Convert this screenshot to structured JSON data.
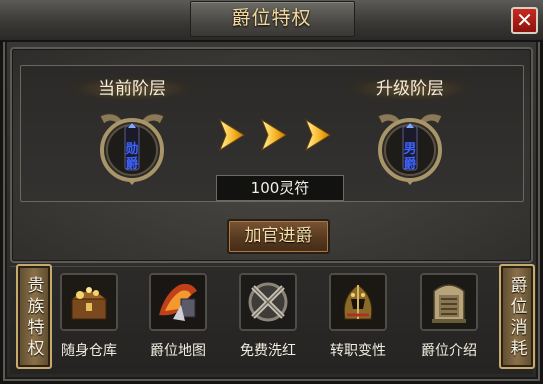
{
  "window": {
    "title": "爵位特权",
    "close_glyph": "✕"
  },
  "current": {
    "label": "当前阶层",
    "rank_chars": [
      "勋",
      "爵"
    ]
  },
  "next": {
    "label": "升级阶层",
    "rank_chars": [
      "男",
      "爵"
    ]
  },
  "cost": "100灵符",
  "upgrade_button": "加官进爵",
  "left_tab": {
    "chars": [
      "贵",
      "族",
      "特",
      "权"
    ]
  },
  "right_tab": {
    "chars": [
      "爵",
      "位",
      "消",
      "耗"
    ]
  },
  "features": [
    {
      "label": "随身仓库",
      "icon": "treasure-chest-icon"
    },
    {
      "label": "爵位地图",
      "icon": "map-icon"
    },
    {
      "label": "免费洗红",
      "icon": "crossed-swords-icon"
    },
    {
      "label": "转职变性",
      "icon": "helmet-icon"
    },
    {
      "label": "爵位介绍",
      "icon": "tablet-icon"
    }
  ],
  "colors": {
    "accent_gold": "#f5b020",
    "rank_blue": "#3c62ff",
    "close_red": "#b0201a"
  }
}
